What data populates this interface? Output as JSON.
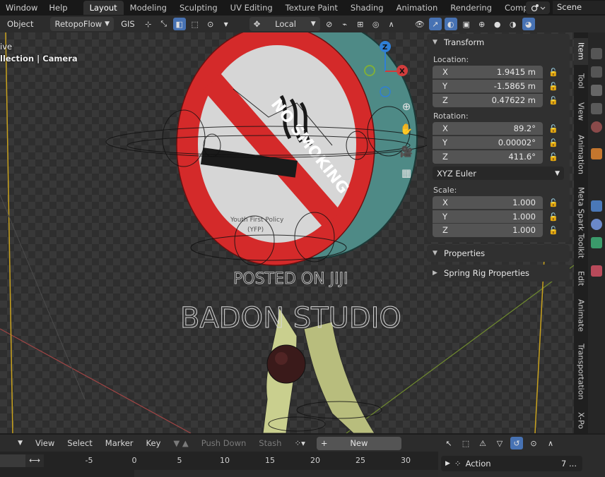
{
  "topbar": {
    "menu": [
      "Window",
      "Help"
    ],
    "workspaces": [
      {
        "label": "Layout",
        "active": true
      },
      {
        "label": "Modeling",
        "active": false
      },
      {
        "label": "Sculpting",
        "active": false
      },
      {
        "label": "UV Editing",
        "active": false
      },
      {
        "label": "Texture Paint",
        "active": false
      },
      {
        "label": "Shading",
        "active": false
      },
      {
        "label": "Animation",
        "active": false
      },
      {
        "label": "Rendering",
        "active": false
      },
      {
        "label": "Compos",
        "active": false
      }
    ],
    "scene_label": "Scene"
  },
  "header": {
    "mode": "Object",
    "addon": "RetopoFlow",
    "gis": "GIS",
    "transform_orientation": "Local"
  },
  "viewport": {
    "info_line1": "ive",
    "info_line2": "llection | Camera",
    "sign_text": "NO SMOKING",
    "sign_subtext_1": "Youth First Policy",
    "sign_subtext_2": "(YFP)",
    "watermark_1": "POSTED ON JIJI",
    "watermark_2": "BADON STUDIO",
    "gizmo": {
      "z": "Z",
      "x": "X"
    }
  },
  "npanel": {
    "transform_title": "Transform",
    "location_label": "Location:",
    "location": [
      {
        "axis": "X",
        "value": "1.9415 m"
      },
      {
        "axis": "Y",
        "value": "-1.5865 m"
      },
      {
        "axis": "Z",
        "value": "0.47622 m"
      }
    ],
    "rotation_label": "Rotation:",
    "rotation": [
      {
        "axis": "X",
        "value": "89.2°"
      },
      {
        "axis": "Y",
        "value": "0.00002°"
      },
      {
        "axis": "Z",
        "value": "411.6°"
      }
    ],
    "rotation_mode": "XYZ Euler",
    "scale_label": "Scale:",
    "scale": [
      {
        "axis": "X",
        "value": "1.000"
      },
      {
        "axis": "Y",
        "value": "1.000"
      },
      {
        "axis": "Z",
        "value": "1.000"
      }
    ],
    "properties_title": "Properties",
    "spring_title": "Spring Rig Properties"
  },
  "vtabs": [
    "Item",
    "Tool",
    "View",
    "Animation",
    "Meta Spark Toolkit",
    "Edit",
    "Animate",
    "Transportation",
    "X-Po"
  ],
  "timeline": {
    "menu": [
      "View",
      "Select",
      "Marker",
      "Key"
    ],
    "push_down": "Push Down",
    "stash": "Stash",
    "new_label": "New",
    "ticks": [
      "-5",
      "0",
      "5",
      "10",
      "15",
      "20",
      "25",
      "30"
    ],
    "action_label": "Action",
    "action_count": "7 ..."
  },
  "colors": {
    "accent": "#4772b3",
    "sign_red": "#d42a2a",
    "sign_teal": "#4e8a86",
    "leg": "#c9cf8e"
  }
}
